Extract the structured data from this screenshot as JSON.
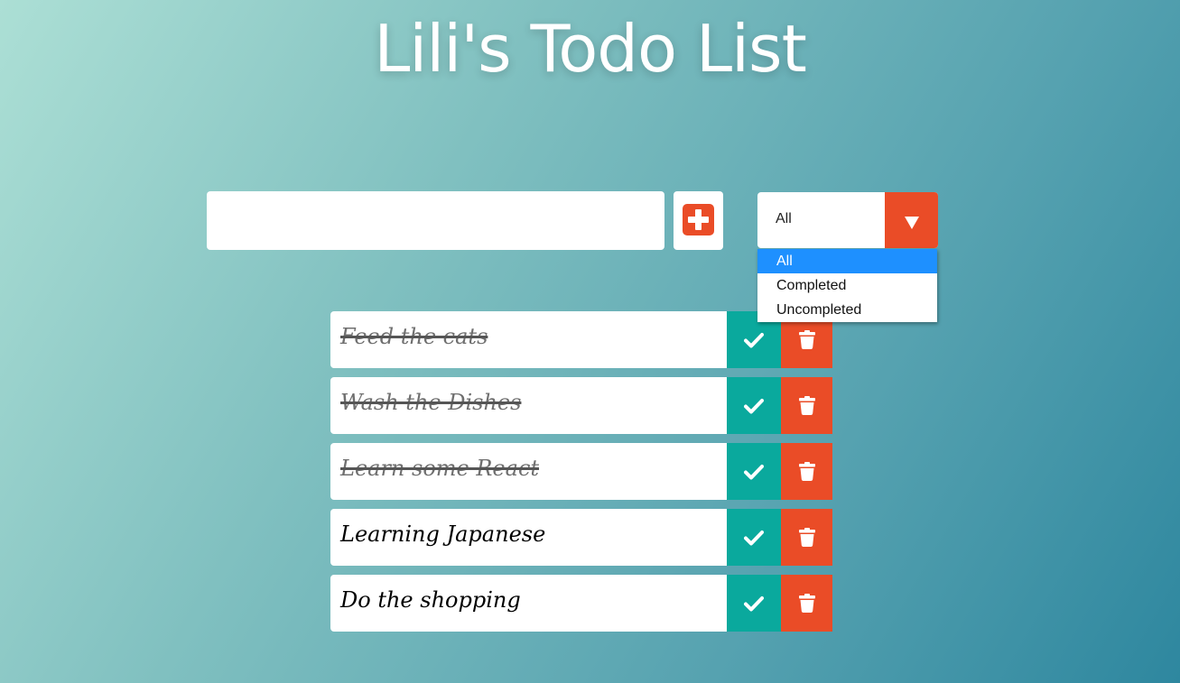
{
  "header": {
    "title": "Lili's Todo List"
  },
  "form": {
    "input_value": "",
    "add_icon": "plus-square-icon",
    "filter": {
      "selected": "All",
      "options": [
        "All",
        "Completed",
        "Uncompleted"
      ],
      "highlighted": "All"
    }
  },
  "todos": [
    {
      "text": "Feed the cats",
      "completed": true
    },
    {
      "text": "Wash the Dishes",
      "completed": true
    },
    {
      "text": "Learn some React",
      "completed": true
    },
    {
      "text": "Learning Japanese",
      "completed": false
    },
    {
      "text": "Do the shopping",
      "completed": false
    }
  ],
  "icons": {
    "complete": "check-icon",
    "delete": "trash-icon"
  },
  "colors": {
    "accent_orange": "#ea4c27",
    "accent_teal": "#0aa99d",
    "highlight_blue": "#1e90ff",
    "gradient_start": "#acdfd5",
    "gradient_end": "#2e879f"
  }
}
